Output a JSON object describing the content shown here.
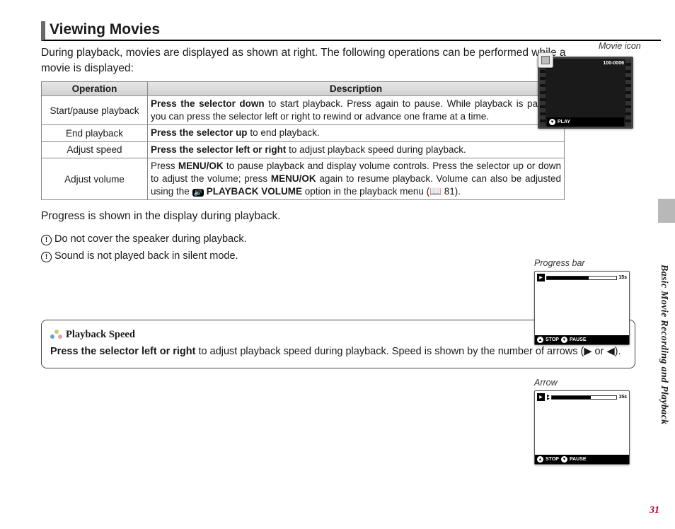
{
  "heading": "Viewing Movies",
  "intro": "During playback, movies are displayed as shown at right.  The following operations can be performed while a movie is displayed:",
  "movieIconLabel": "Movie icon",
  "table": {
    "headers": {
      "op": "Operation",
      "desc": "Description"
    },
    "rows": [
      {
        "op": "Start/pause playback",
        "bold": "Press the selector down",
        "rest": " to start playback.  Press again to pause.  While playback is paused, you can press the selector left or right to rewind or advance one frame at a time."
      },
      {
        "op": "End playback",
        "bold": "Press the selector up",
        "rest": " to end playback."
      },
      {
        "op": "Adjust speed",
        "bold": "Press the selector left or right",
        "rest": " to adjust playback speed during playback."
      },
      {
        "op": "Adjust volume",
        "pre": "Press ",
        "b1": "MENU/OK",
        "mid1": " to pause playback and display volume controls.  Press the selector up or down to adjust the volume; press ",
        "b2": "MENU/OK",
        "mid2": " again to resume playback.  Volume can also be adjusted using the ",
        "icon": "🔊",
        "b3": "PLAYBACK VOLUME",
        "mid3": " option in the playback menu (📖 81)."
      }
    ]
  },
  "progressLine": "Progress is shown in the display during playback.",
  "notes": [
    "Do not cover the speaker during playback.",
    "Sound is not played back in silent mode."
  ],
  "callout": {
    "title": "Playback Speed",
    "bold": "Press the selector left or right",
    "rest": " to adjust playback speed during playback.  Speed is shown by the number of arrows (▶ or ◀)."
  },
  "screen1": {
    "code": "100-0006",
    "play": "PLAY"
  },
  "progLabel": "Progress bar",
  "arrowLabel": "Arrow",
  "screenProg": {
    "time": "15s",
    "stop": "STOP",
    "pause": "PAUSE"
  },
  "sideText": "Basic Movie Recording and Playback",
  "pageNum": "31"
}
